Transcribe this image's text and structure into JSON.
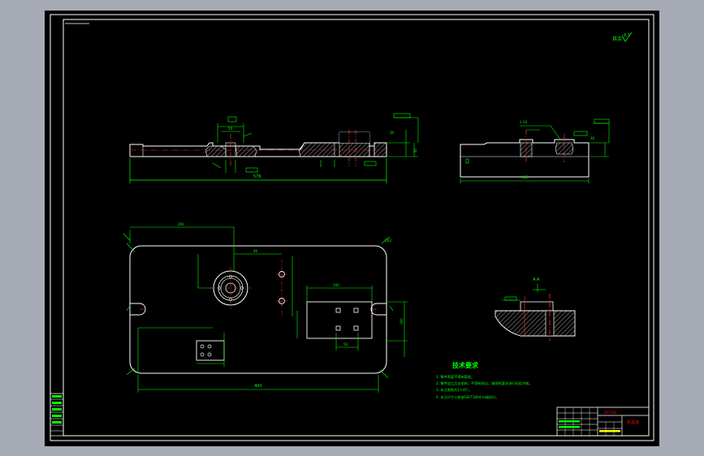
{
  "colors": {
    "app_background": "#a6aab5",
    "viewport": "#000000",
    "frame": "#ffffff",
    "outline": "#ffffff",
    "dimension": "#00ff00",
    "center_line": "#ff3030",
    "hatch": "#808080",
    "notes_title": "#00ff00",
    "notes": "#00ff00",
    "title_block_red": "#ff0000",
    "title_block_yellow": "#ffff00"
  },
  "roughness": {
    "label": "其余",
    "value": "6.3"
  },
  "front_view": {
    "dims": {
      "overall_length": "576",
      "hub_spacing": "50",
      "thickness": "30",
      "height": "40"
    }
  },
  "side_view": {
    "dims": {
      "width": "163",
      "height": "30",
      "note": "1:10"
    }
  },
  "plan_view": {
    "dims": {
      "width": "400",
      "height": "160",
      "to_center": "200",
      "hole_spacing": "50",
      "pocket_width": "100",
      "inner_gap": "40",
      "corner_radius": "R20"
    }
  },
  "section_view": {
    "label": "A-A"
  },
  "tech_notes": {
    "title": "技术要求",
    "items": [
      "1. 零件表面不得有裂纹。",
      "2. 零件加工后去毛刺，不得有锐边，按图纸要求进行检验合格。",
      "3. 未注倒角为1×45°。",
      "4. 未注尺寸公差按GB/T1804-m级执行。"
    ]
  },
  "title_block": {
    "drawing_name": "夹具体",
    "material": "HT200"
  }
}
